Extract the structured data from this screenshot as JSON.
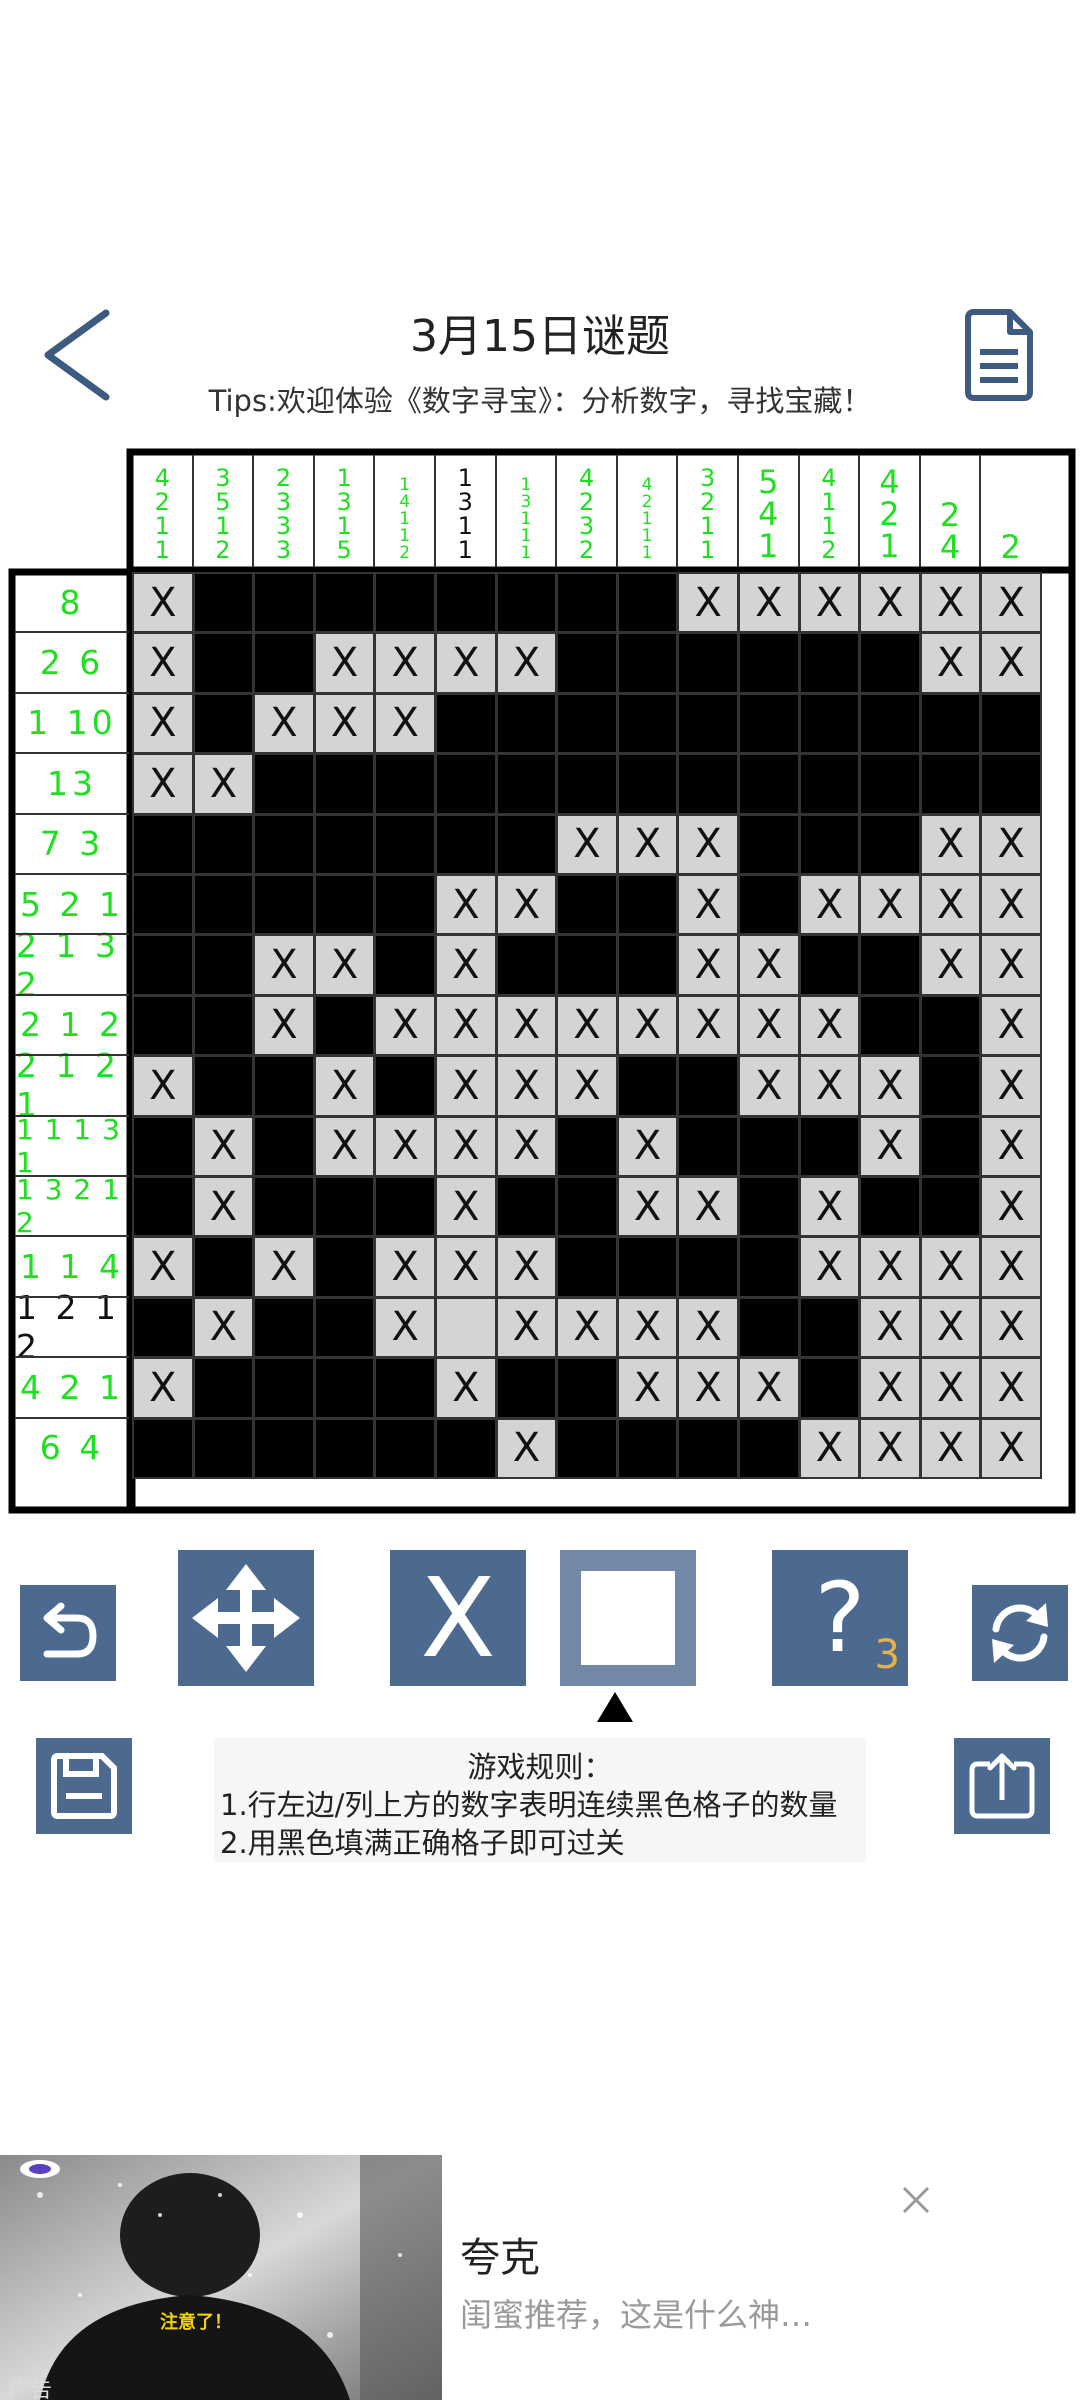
{
  "header": {
    "title": "3月15日谜题",
    "tips": "Tips:欢迎体验《数字寻宝》：分析数字，寻找宝藏！",
    "back_icon": "chevron-left-icon",
    "doc_icon": "document-icon"
  },
  "colors": {
    "accent": "#4c6a90",
    "clue_green": "#1ee01e",
    "clue_done": "#111111",
    "cell_empty": "#d4d4d4",
    "cell_filled": "#000000"
  },
  "puzzle": {
    "size": 15,
    "column_clues": [
      {
        "nums": [
          "4",
          "2",
          "1",
          "1"
        ],
        "done": false
      },
      {
        "nums": [
          "3",
          "5",
          "1",
          "2"
        ],
        "done": false
      },
      {
        "nums": [
          "2",
          "3",
          "3",
          "3"
        ],
        "done": false
      },
      {
        "nums": [
          "1",
          "3",
          "1",
          "5"
        ],
        "done": false
      },
      {
        "nums": [
          "1",
          "4",
          "1",
          "1",
          "2"
        ],
        "done": false
      },
      {
        "nums": [
          "1",
          "3",
          "1",
          "1"
        ],
        "done": true
      },
      {
        "nums": [
          "1",
          "3",
          "1",
          "1",
          "1"
        ],
        "done": false
      },
      {
        "nums": [
          "4",
          "2",
          "3",
          "2"
        ],
        "done": false
      },
      {
        "nums": [
          "4",
          "2",
          "1",
          "1",
          "1"
        ],
        "done": false
      },
      {
        "nums": [
          "3",
          "2",
          "1",
          "1"
        ],
        "done": false
      },
      {
        "nums": [
          "5",
          "4",
          "1"
        ],
        "done": false
      },
      {
        "nums": [
          "4",
          "1",
          "1",
          "2"
        ],
        "done": false
      },
      {
        "nums": [
          "4",
          "2",
          "1"
        ],
        "done": false
      },
      {
        "nums": [
          "2",
          "4"
        ],
        "done": false
      },
      {
        "nums": [
          "2"
        ],
        "done": false
      }
    ],
    "row_clues": [
      {
        "text": "8",
        "done": false
      },
      {
        "text": "2 6",
        "done": false
      },
      {
        "text": "1 10",
        "done": false
      },
      {
        "text": "13",
        "done": false
      },
      {
        "text": "7 3",
        "done": false
      },
      {
        "text": "5 2 1",
        "done": false
      },
      {
        "text": "2 1 3 2",
        "done": false
      },
      {
        "text": "2 1 2",
        "done": false
      },
      {
        "text": "2 1 2 1",
        "done": false
      },
      {
        "text": "1 1 1 3 1",
        "done": false
      },
      {
        "text": "1 3 2 1 2",
        "done": false
      },
      {
        "text": "1 1 4",
        "done": false
      },
      {
        "text": "1 2 1 2",
        "done": true
      },
      {
        "text": "4 2 1",
        "done": false
      },
      {
        "text": "6 4",
        "done": false
      }
    ],
    "grid": [
      "XBBBBBBBBXXXXXX",
      "XBBXXXXBBBBBBXX",
      "XBXXXBBBBBBBBBB",
      "XXBBBBBBBBBBBBB",
      "BBBBBBBXXXBBBXX",
      "BBBBBXXBBXBXXXX",
      "BBXXBXBBBXXBBXX",
      "BBXBXXXXXXXXBBX",
      "XBBXBXXXBBXXXBX",
      "BXBXXXXBXBBBXBX",
      "BXBBBXBBXXBXBBX",
      "XBXBXXXBBBBXXXX",
      "BXBBX.XXXXBBXXX",
      "XBBBBXBBXXXBXXX",
      "BBBBBBXBBBBXXXX"
    ]
  },
  "toolbar": {
    "undo_icon": "undo-icon",
    "move_icon": "move-arrows-icon",
    "x_label": "X",
    "fill_icon": "fill-square-icon",
    "hint_label": "?",
    "hint_count": "3",
    "reset_icon": "refresh-icon",
    "save_icon": "save-icon",
    "share_icon": "share-icon"
  },
  "rules": {
    "title": "游戏规则：",
    "line1": "1.行左边/列上方的数字表明连续黑色格子的数量",
    "line2": "2.用黑色填满正确格子即可过关"
  },
  "ad": {
    "title": "夸克",
    "description": "闺蜜推荐，这是什么神…",
    "label": "广告",
    "image_text": "注意了！"
  }
}
